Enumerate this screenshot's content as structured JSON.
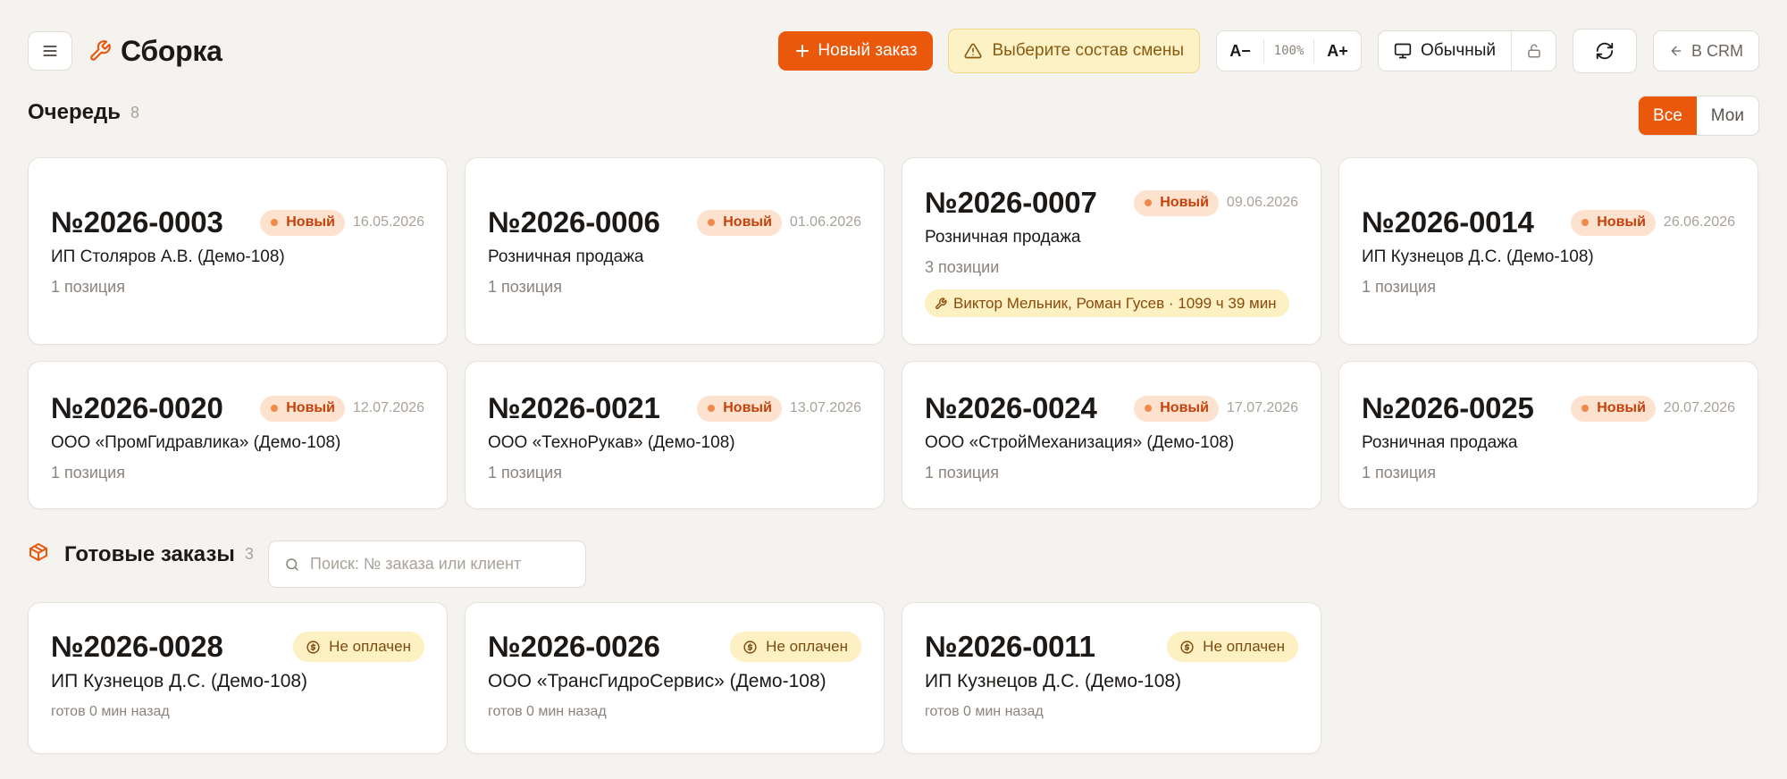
{
  "header": {
    "title": "Сборка",
    "new_order_label": "Новый заказ",
    "shift_warning": "Выберите состав смены",
    "font_decrease": "A−",
    "zoom": "100%",
    "font_increase": "A+",
    "mode_label": "Обычный",
    "back_to_crm": "В CRM"
  },
  "queue": {
    "title": "Очередь",
    "count": "8",
    "filters": [
      "Все",
      "Мои"
    ],
    "active_filter": "Все",
    "orders": [
      {
        "number": "№2026-0003",
        "status": "Новый",
        "date": "16.05.2026",
        "client": "ИП Столяров А.В. (Демо-108)",
        "positions": "1 позиция"
      },
      {
        "number": "№2026-0006",
        "status": "Новый",
        "date": "01.06.2026",
        "client": "Розничная продажа",
        "positions": "1 позиция"
      },
      {
        "number": "№2026-0007",
        "status": "Новый",
        "date": "09.06.2026",
        "client": "Розничная продажа",
        "positions": "3 позиции",
        "workers": "Виктор Мельник, Роман Гусев · 1099 ч 39 мин"
      },
      {
        "number": "№2026-0014",
        "status": "Новый",
        "date": "26.06.2026",
        "client": "ИП Кузнецов Д.С. (Демо-108)",
        "positions": "1 позиция"
      },
      {
        "number": "№2026-0020",
        "status": "Новый",
        "date": "12.07.2026",
        "client": "ООО «ПромГидравлика» (Демо-108)",
        "positions": "1 позиция"
      },
      {
        "number": "№2026-0021",
        "status": "Новый",
        "date": "13.07.2026",
        "client": "ООО «ТехноРукав» (Демо-108)",
        "positions": "1 позиция"
      },
      {
        "number": "№2026-0024",
        "status": "Новый",
        "date": "17.07.2026",
        "client": "ООО «СтройМеханизация» (Демо-108)",
        "positions": "1 позиция"
      },
      {
        "number": "№2026-0025",
        "status": "Новый",
        "date": "20.07.2026",
        "client": "Розничная продажа",
        "positions": "1 позиция"
      }
    ]
  },
  "ready": {
    "title": "Готовые заказы",
    "count": "3",
    "search_placeholder": "Поиск: № заказа или клиент",
    "orders": [
      {
        "number": "№2026-0028",
        "payment": "Не оплачен",
        "client": "ИП Кузнецов Д.С. (Демо-108)",
        "ready_time": "готов 0 мин назад"
      },
      {
        "number": "№2026-0026",
        "payment": "Не оплачен",
        "client": "ООО «ТрансГидроСервис» (Демо-108)",
        "ready_time": "готов 0 мин назад"
      },
      {
        "number": "№2026-0011",
        "payment": "Не оплачен",
        "client": "ИП Кузнецов Д.С. (Демо-108)",
        "ready_time": "готов 0 мин назад"
      }
    ]
  },
  "colors": {
    "accent": "#ea580c",
    "background": "#f5f3ef",
    "badge_new_bg": "#fde3cf",
    "warning_bg": "#fdf2c5"
  }
}
